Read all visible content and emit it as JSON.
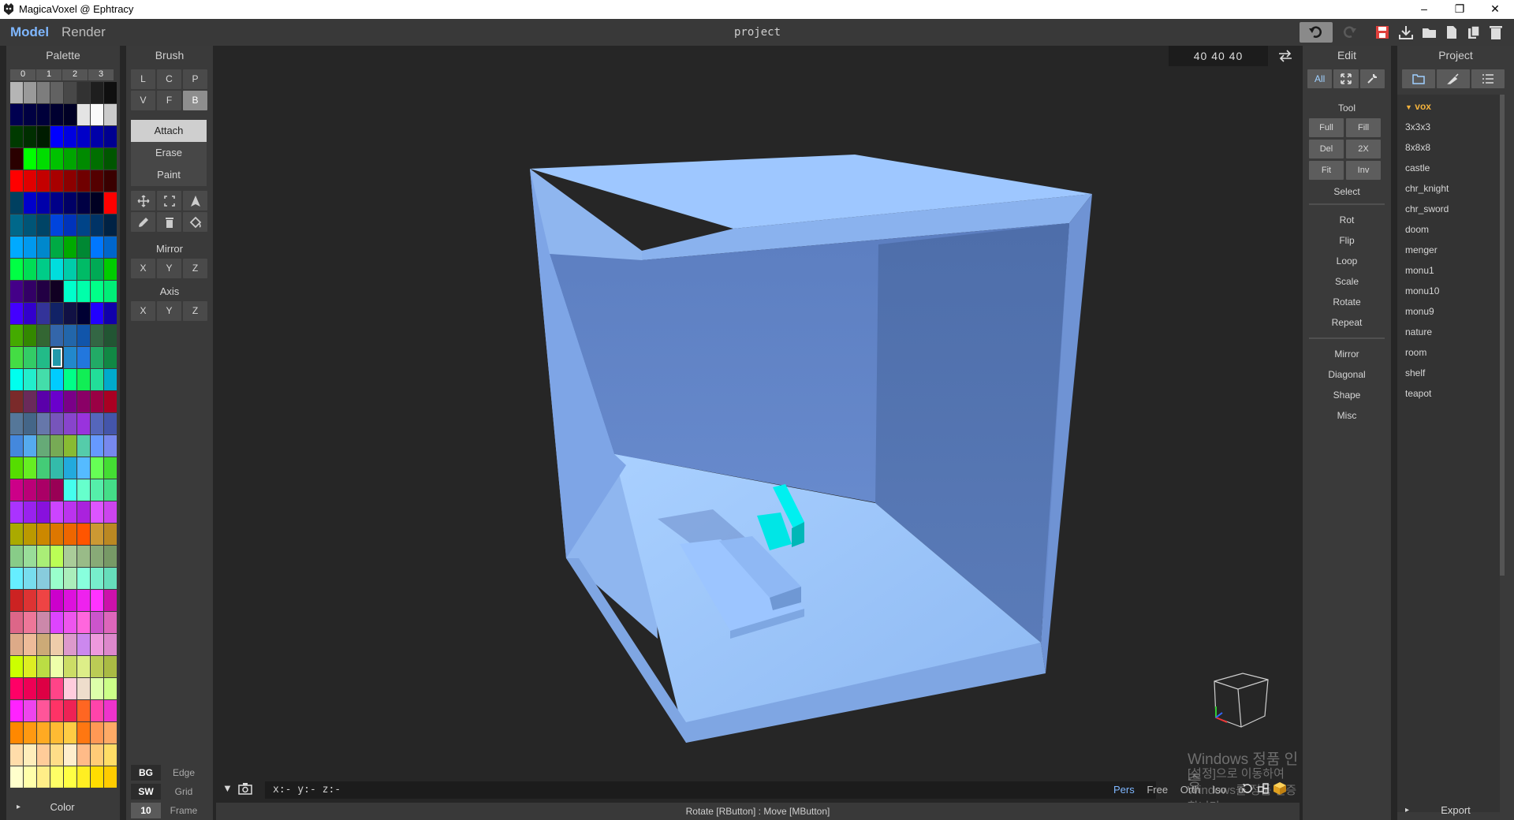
{
  "window": {
    "title": "MagicaVoxel @ Ephtracy",
    "buttons": [
      "–",
      "❐",
      "✕"
    ]
  },
  "modes": {
    "model": "Model",
    "render": "Render"
  },
  "project_name": "project",
  "palette": {
    "header": "Palette",
    "pages": [
      "0",
      "1",
      "2",
      "3"
    ],
    "footer": "Color",
    "selected_index": 99,
    "colors": [
      "#b5b5b5",
      "#9a9a9a",
      "#7d7d7d",
      "#626262",
      "#484848",
      "#323232",
      "#1e1e1e",
      "#0f0f0f",
      "#000050",
      "#000042",
      "#00003a",
      "#000030",
      "#000025",
      "#e4e4e4",
      "#fafafa",
      "#cbcbcb",
      "#003a00",
      "#002e00",
      "#001c00",
      "#0000ff",
      "#0000e0",
      "#0000c8",
      "#0000a8",
      "#000090",
      "#2a0000",
      "#00ff00",
      "#00dd00",
      "#00c200",
      "#00a500",
      "#008a00",
      "#006f00",
      "#005600",
      "#ff0000",
      "#e00000",
      "#c40000",
      "#a80000",
      "#8c0000",
      "#700000",
      "#540000",
      "#3a0000",
      "#004060",
      "#0000cc",
      "#0000aa",
      "#000088",
      "#000066",
      "#000044",
      "#000022",
      "#ff0000",
      "#00688a",
      "#005577",
      "#004466",
      "#0044dd",
      "#0033bb",
      "#004488",
      "#003366",
      "#002244",
      "#00aaff",
      "#0099ee",
      "#0088cc",
      "#00aa44",
      "#00aa00",
      "#008833",
      "#0077ff",
      "#0066cc",
      "#00ff44",
      "#00dd55",
      "#00cc88",
      "#00dddd",
      "#00ccaa",
      "#00bb66",
      "#00aa55",
      "#00cc00",
      "#440088",
      "#330066",
      "#220044",
      "#110022",
      "#00ffcc",
      "#00ffaa",
      "#00ff88",
      "#00ee77",
      "#4400ff",
      "#3300cc",
      "#333399",
      "#112266",
      "#111144",
      "#000033",
      "#2200ff",
      "#1100aa",
      "#44aa00",
      "#338800",
      "#336633",
      "#3366aa",
      "#2266aa",
      "#1155aa",
      "#336644",
      "#225533",
      "#44dd44",
      "#33cc66",
      "#22bb88",
      "#2299aa",
      "#2288cc",
      "#2277dd",
      "#22aa66",
      "#118844",
      "#00ffee",
      "#22eecc",
      "#44ddaa",
      "#00ccff",
      "#00ff88",
      "#11ee55",
      "#22dd99",
      "#00aacc",
      "#7a2a2a",
      "#6a2a5a",
      "#5a00aa",
      "#6a00cc",
      "#7a0088",
      "#8a0066",
      "#9a0044",
      "#aa0022",
      "#557799",
      "#446688",
      "#6677aa",
      "#7755bb",
      "#8844cc",
      "#9933dd",
      "#5566bb",
      "#4455aa",
      "#4488dd",
      "#55aaee",
      "#66aa77",
      "#77aa55",
      "#88bb33",
      "#55ccaa",
      "#6699ff",
      "#7788ee",
      "#55dd00",
      "#66ee22",
      "#44cc77",
      "#33bbaa",
      "#22aadd",
      "#55bbff",
      "#66ff55",
      "#44dd33",
      "#cc0088",
      "#bb0077",
      "#aa0066",
      "#990055",
      "#44ffee",
      "#66ffcc",
      "#55eeaa",
      "#44dd88",
      "#aa33ff",
      "#9922ee",
      "#8811dd",
      "#cc44ff",
      "#bb33ee",
      "#aa22dd",
      "#dd55ff",
      "#cc44ee",
      "#aaaa00",
      "#bb9900",
      "#cc8800",
      "#dd7700",
      "#ee6600",
      "#ff5500",
      "#cc9933",
      "#bb8822",
      "#88cc88",
      "#99dd99",
      "#aaee77",
      "#bbff55",
      "#aacc99",
      "#99bb88",
      "#88aa77",
      "#779966",
      "#66eeff",
      "#77ddee",
      "#88ccdd",
      "#99ffcc",
      "#aaeebb",
      "#88ffdd",
      "#77eecc",
      "#66ddbb",
      "#cc2222",
      "#dd3333",
      "#ee4444",
      "#cc00cc",
      "#dd11dd",
      "#ee22ee",
      "#ff33ff",
      "#cc11aa",
      "#dd6688",
      "#ee7799",
      "#cc88aa",
      "#dd44ff",
      "#ee55ee",
      "#ff66dd",
      "#cc55cc",
      "#dd66bb",
      "#ddaa88",
      "#eebb99",
      "#ccaa77",
      "#eeccaa",
      "#dd99cc",
      "#cc88ee",
      "#ee99dd",
      "#dd88cc",
      "#ccff00",
      "#ddee22",
      "#bbdd44",
      "#eeffaa",
      "#ccdd66",
      "#ddee88",
      "#bbcc55",
      "#aabb44",
      "#ff0066",
      "#ee0055",
      "#dd0044",
      "#ff4488",
      "#ffccdd",
      "#eeddcc",
      "#ddffaa",
      "#ccff88",
      "#ff22ff",
      "#ee44ee",
      "#ff5599",
      "#ff3366",
      "#ee2255",
      "#ff6622",
      "#ff44aa",
      "#ee33cc",
      "#ff8800",
      "#ff9911",
      "#ffaa22",
      "#ffbb33",
      "#ffcc44",
      "#ff7711",
      "#ff9955",
      "#ffaa66",
      "#ffddaa",
      "#ffeebb",
      "#ffcc99",
      "#ffdd88",
      "#ffeecc",
      "#ffbb88",
      "#ffcc77",
      "#ffdd66",
      "#ffffcc",
      "#ffffaa",
      "#ffee88",
      "#ffff66",
      "#ffff44",
      "#ffee22",
      "#ffdd00",
      "#ffcc00"
    ]
  },
  "brush": {
    "header": "Brush",
    "types_row1": [
      "L",
      "C",
      "P"
    ],
    "types_row2": [
      "V",
      "F",
      "B"
    ],
    "active_type": "B",
    "modes": [
      "Attach",
      "Erase",
      "Paint"
    ],
    "active_mode": "Attach",
    "tools_row1": [
      "move-icon",
      "select-box-icon",
      "cone-icon"
    ],
    "tools_row2": [
      "eyedropper-icon",
      "trash-icon",
      "bucket-icon"
    ],
    "mirror_label": "Mirror",
    "mirror_axes": [
      "X",
      "Y",
      "Z"
    ],
    "axis_label": "Axis",
    "axis_axes": [
      "X",
      "Y",
      "Z"
    ],
    "footer": [
      {
        "key": "BG",
        "value": "Edge"
      },
      {
        "key": "SW",
        "value": "Grid"
      },
      {
        "key": "10",
        "value": "Frame"
      }
    ]
  },
  "viewport": {
    "dimensions": "40 40 40",
    "coords": "x:-    y:-    z:-",
    "view_modes": [
      "Pers",
      "Free",
      "Orth",
      "Iso",
      "0"
    ],
    "active_view": "Pers",
    "watermark_line1": "Windows 정품 인증",
    "watermark_line2": "[설정]으로 이동하여 Windows를 정품 인증합니다."
  },
  "status_text": "Rotate [RButton] : Move [MButton]",
  "edit": {
    "header": "Edit",
    "filters": [
      "All",
      "expand-icon",
      "wrench-icon"
    ],
    "tool_label": "Tool",
    "tool_buttons": [
      "Full",
      "Fill",
      "Del",
      "2X",
      "Fit",
      "Inv"
    ],
    "select": "Select",
    "group1": [
      "Rot",
      "Flip",
      "Loop",
      "Scale",
      "Rotate",
      "Repeat"
    ],
    "group2": [
      "Mirror",
      "Diagonal",
      "Shape",
      "Misc"
    ]
  },
  "project": {
    "header": "Project",
    "folder": "vox",
    "items": [
      "3x3x3",
      "8x8x8",
      "castle",
      "chr_knight",
      "chr_sword",
      "doom",
      "menger",
      "monu1",
      "monu10",
      "monu9",
      "nature",
      "room",
      "shelf",
      "teapot"
    ],
    "export": "Export"
  },
  "colors": {
    "accent": "#7fb7ff",
    "folder": "#f3b23c",
    "save": "#e0403c",
    "voxel_light": "#9cc8ff",
    "voxel_dark": "#5a7fc2"
  }
}
